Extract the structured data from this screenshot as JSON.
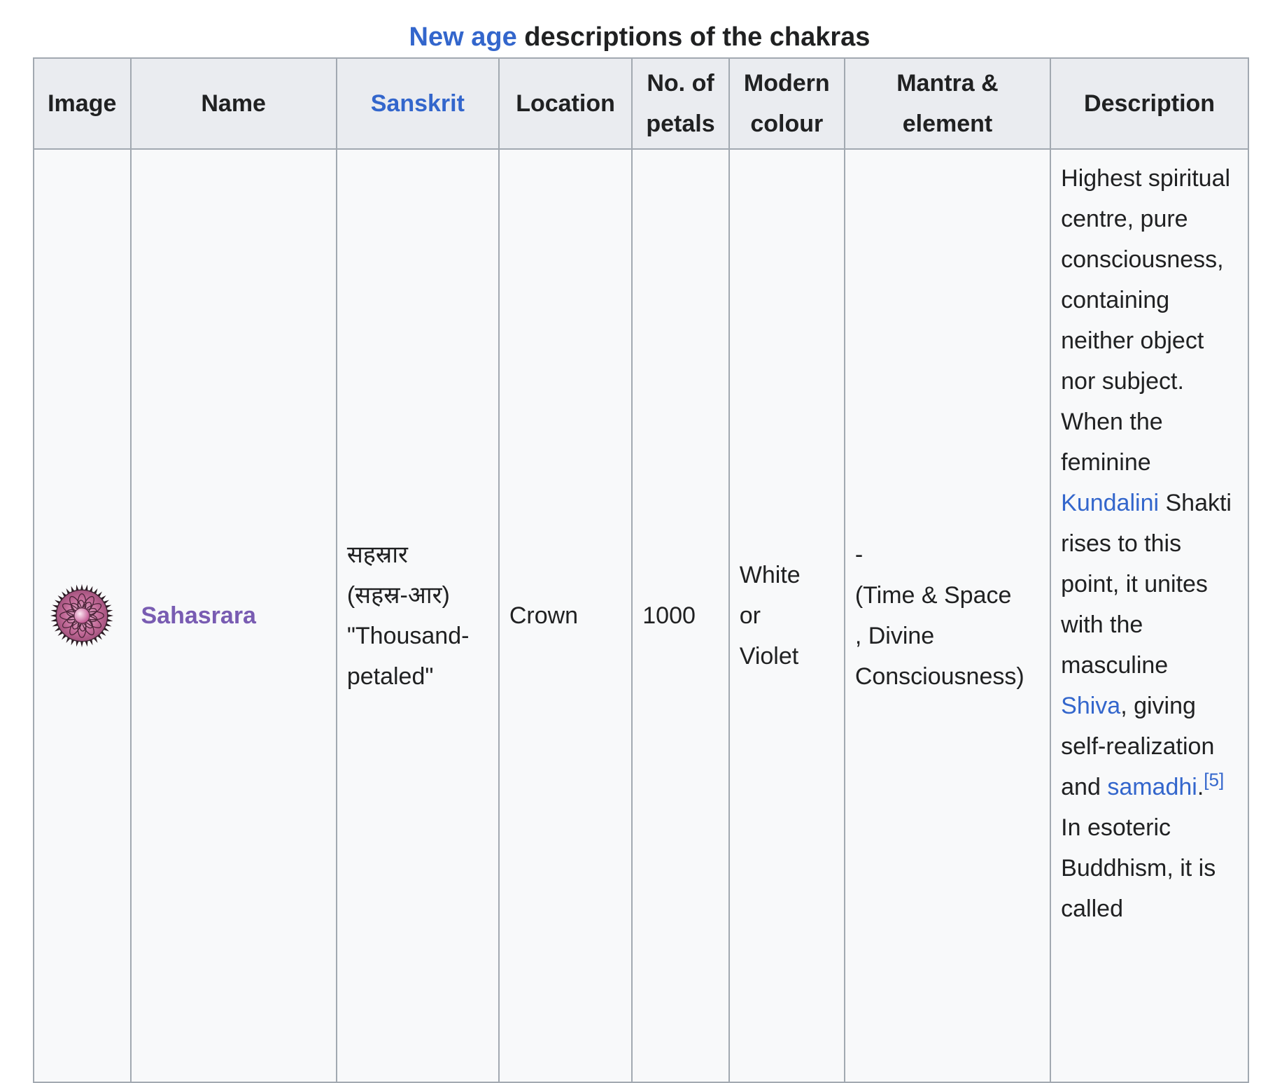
{
  "caption": {
    "link_text": "New age",
    "rest": " descriptions of the chakras"
  },
  "headers": {
    "image": "Image",
    "name": "Name",
    "sanskrit": "Sanskrit",
    "location": "Location",
    "petals_line1": "No. of",
    "petals_line2": "petals",
    "colour_line1": "Modern",
    "colour_line2": "colour",
    "mantra_line1": "Mantra &",
    "mantra_line2": "element",
    "description": "Description"
  },
  "row": {
    "image_icon": "sahasrara-lotus-icon",
    "name": "Sahasrara",
    "sanskrit_line1": "सहस्रार",
    "sanskrit_line2": "(सहस्र-आर)",
    "sanskrit_line3": "\"Thousand-",
    "sanskrit_line4": "petaled\"",
    "location": "Crown",
    "petals": "1000",
    "colour_line1": "White",
    "colour_line2": "or",
    "colour_line3": "Violet",
    "mantra_line1": "-",
    "mantra_line2": "(Time & Space",
    "mantra_line3": ", Divine",
    "mantra_line4": "Consciousness)",
    "description": {
      "p1": "Highest spiritual centre, pure consciousness, containing neither object nor subject. When the feminine ",
      "link_kundalini": "Kundalini",
      "p2": " Shakti rises to this point, it unites with the masculine ",
      "link_shiva": "Shiva",
      "p3": ", giving self-realization and ",
      "link_samadhi": "samadhi",
      "p4": ".",
      "ref": "[5]",
      "p5": " In esoteric Buddhism, it is called"
    }
  },
  "colors": {
    "link": "#3366cc",
    "visited_link": "#795cb2",
    "header_bg": "#eaecf0",
    "cell_bg": "#f8f9fa",
    "border": "#a2a9b1"
  }
}
